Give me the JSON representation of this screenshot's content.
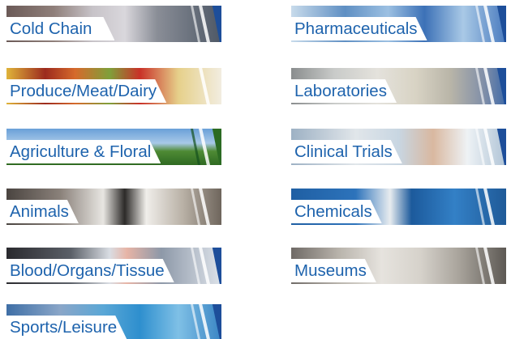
{
  "tiles": [
    {
      "label": "Cold Chain"
    },
    {
      "label": "Pharmaceuticals"
    },
    {
      "label": "Produce/Meat/Dairy"
    },
    {
      "label": "Laboratories"
    },
    {
      "label": "Agriculture & Floral"
    },
    {
      "label": "Clinical Trials"
    },
    {
      "label": "Animals"
    },
    {
      "label": "Chemicals"
    },
    {
      "label": "Blood/Organs/Tissue"
    },
    {
      "label": "Museums"
    },
    {
      "label": "Sports/Leisure"
    }
  ]
}
